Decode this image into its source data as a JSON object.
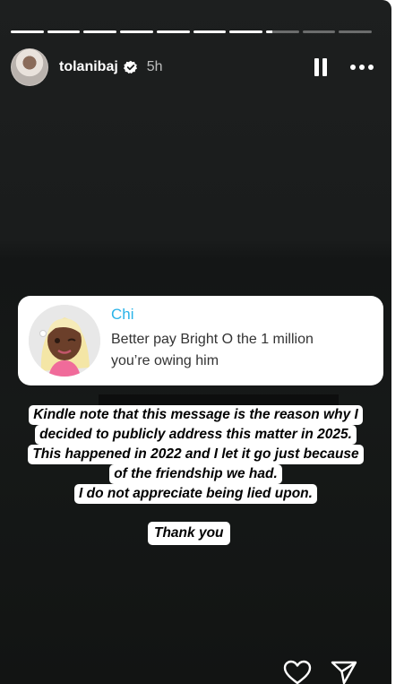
{
  "progress": {
    "segments_total": 10,
    "completed_segments": 7,
    "current_segment_fraction": 0.2
  },
  "header": {
    "username": "tolanibaj",
    "time_ago": "5h",
    "verified": true
  },
  "message_card": {
    "sender_name": "Chi",
    "message_line1": "Better pay Bright O the 1 million",
    "message_line2": "you’re owing him"
  },
  "caption": {
    "line1": "Kindle note that this message is the reason why I",
    "line2": "decided to publicly address this matter in 2025.",
    "line3": "This happened in 2022 and I let it go just because",
    "line4": "of the friendship we had.",
    "line5": "I do not appreciate being lied upon.",
    "thanks": "Thank you"
  },
  "icons": {
    "pause": "pause-icon",
    "more": "more-options-icon",
    "verified": "verified-badge-icon",
    "like": "heart-icon",
    "share": "send-icon"
  },
  "colors": {
    "accent_name": "#2ab3e8",
    "background": "#1a1c1c"
  }
}
